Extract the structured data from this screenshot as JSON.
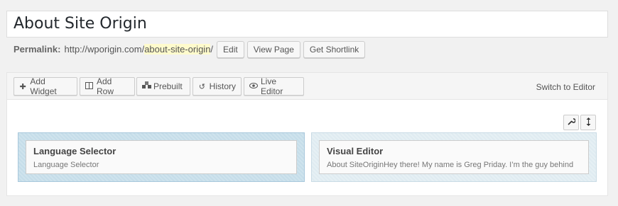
{
  "post": {
    "title": "About Site Origin"
  },
  "permalink": {
    "label": "Permalink:",
    "base": "http://wporigin.com/",
    "slug": "about-site-origin",
    "trailing": "/",
    "edit_label": "Edit",
    "view_label": "View Page",
    "shortlink_label": "Get Shortlink"
  },
  "toolbar": {
    "add_widget": "Add Widget",
    "add_row": "Add Row",
    "prebuilt": "Prebuilt",
    "history": "History",
    "live_editor": "Live Editor",
    "switch_editor": "Switch to Editor"
  },
  "row": {
    "cells": [
      {
        "widget_title": "Language Selector",
        "widget_desc": "Language Selector"
      },
      {
        "widget_title": "Visual Editor",
        "widget_desc": "About SiteOriginHey there! My name is Greg Priday. I’m the guy behind"
      }
    ]
  },
  "icons": {
    "add_widget": "plus-icon",
    "add_row": "columns-icon",
    "prebuilt": "layers-icon",
    "history": "undo-icon",
    "live_editor": "eye-icon",
    "row_settings": "wrench-icon",
    "row_move": "vertical-arrows-icon"
  }
}
